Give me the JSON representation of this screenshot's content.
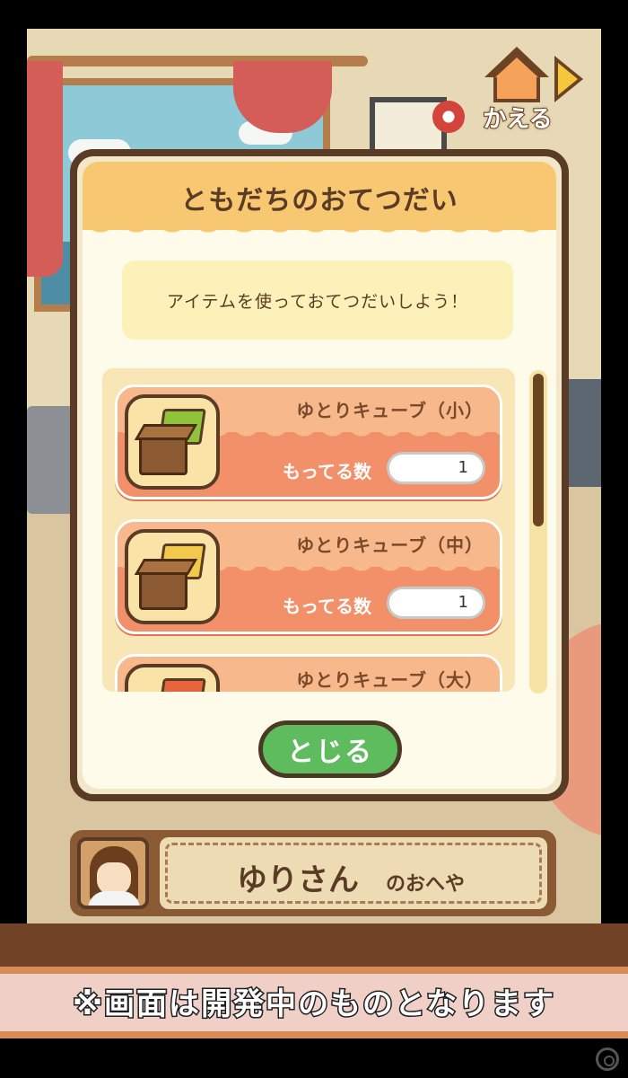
{
  "header": {
    "home_button_label": "かえる"
  },
  "dialog": {
    "title": "ともだちのおてつだい",
    "message": "アイテムを使っておてつだいしよう！",
    "count_label": "もってる数",
    "items": [
      {
        "name": "ゆとりキューブ（小）",
        "count": "1",
        "cube_color": "#8fc43a"
      },
      {
        "name": "ゆとりキューブ（中）",
        "count": "1",
        "cube_color": "#f2c94c"
      },
      {
        "name": "ゆとりキューブ（大）",
        "count": "",
        "cube_color": "#e8643a"
      }
    ],
    "scroll_position": 0,
    "close_button_label": "とじる"
  },
  "room_plate": {
    "owner_name": "ゆりさん",
    "suffix": "のおへや"
  },
  "banner": {
    "notice": "※画面は開発中のものとなります"
  },
  "colors": {
    "dialog_border": "#5a3b25",
    "header": "#f8c771",
    "card": "#f2906a",
    "close_button": "#5ebc5e"
  }
}
